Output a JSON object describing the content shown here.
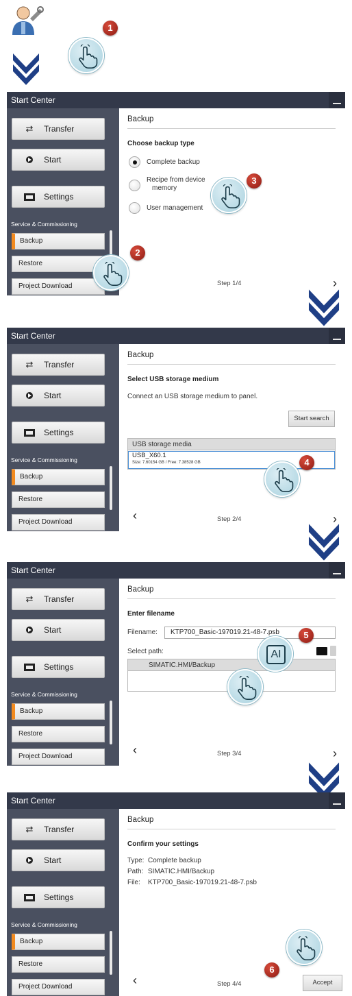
{
  "app_title": "Start Center",
  "nav": {
    "transfer": "Transfer",
    "start": "Start",
    "settings": "Settings"
  },
  "section_heading": "Service & Commissioning",
  "subnav": {
    "backup": "Backup",
    "restore": "Restore",
    "project_download": "Project Download"
  },
  "panel_title": "Backup",
  "step1": {
    "subheading": "Choose backup type",
    "options": [
      "Complete backup",
      "Recipe from device",
      "memory",
      "User management"
    ],
    "selected_option": "Complete backup",
    "step": "Step 1/4"
  },
  "step2": {
    "subheading": "Select USB storage medium",
    "instruction": "Connect an USB storage medium to panel.",
    "search_button": "Start search",
    "table_header": "USB storage media",
    "device_name": "USB_X60.1",
    "device_size": "Size: 7.60154 GB / Free: 7.38528 GB",
    "step": "Step 2/4"
  },
  "step3": {
    "subheading": "Enter filename",
    "filename_label": "Filename:",
    "filename_value": "KTP700_Basic-197019.21-48-7.psb",
    "select_path_label": "Select path:",
    "path_value": "SIMATIC.HMI/Backup",
    "step": "Step 3/4"
  },
  "step4": {
    "subheading": "Confirm your settings",
    "type_label": "Type:",
    "type_value": "Complete backup",
    "path_label": "Path:",
    "path_value": "SIMATIC.HMI/Backup",
    "file_label": "File:",
    "file_value": "KTP700_Basic-197019.21-48-7.psb",
    "step": "Step 4/4",
    "accept_button": "Accept"
  },
  "callouts": [
    "1",
    "2",
    "3",
    "4",
    "5",
    "6"
  ],
  "text_tool_glyph": "A",
  "icons": {
    "service_user": "user-wrench-icon",
    "transfer": "transfer-arrows-icon",
    "start": "play-circle-icon",
    "settings": "settings-icon",
    "folder": "folder-icon",
    "trash": "trash-icon",
    "next": "chevron-right-icon",
    "prev": "chevron-left-icon",
    "flow": "double-chevron-down-icon",
    "tap": "tapping-hand-icon"
  },
  "colors": {
    "titlebar": "#33394a",
    "sidebar": "#4a5060",
    "active_accent": "#f28a1e",
    "selection": "#4a8fd6",
    "callout_number": "#b8281c",
    "flow_arrow": "#1f3f86"
  }
}
